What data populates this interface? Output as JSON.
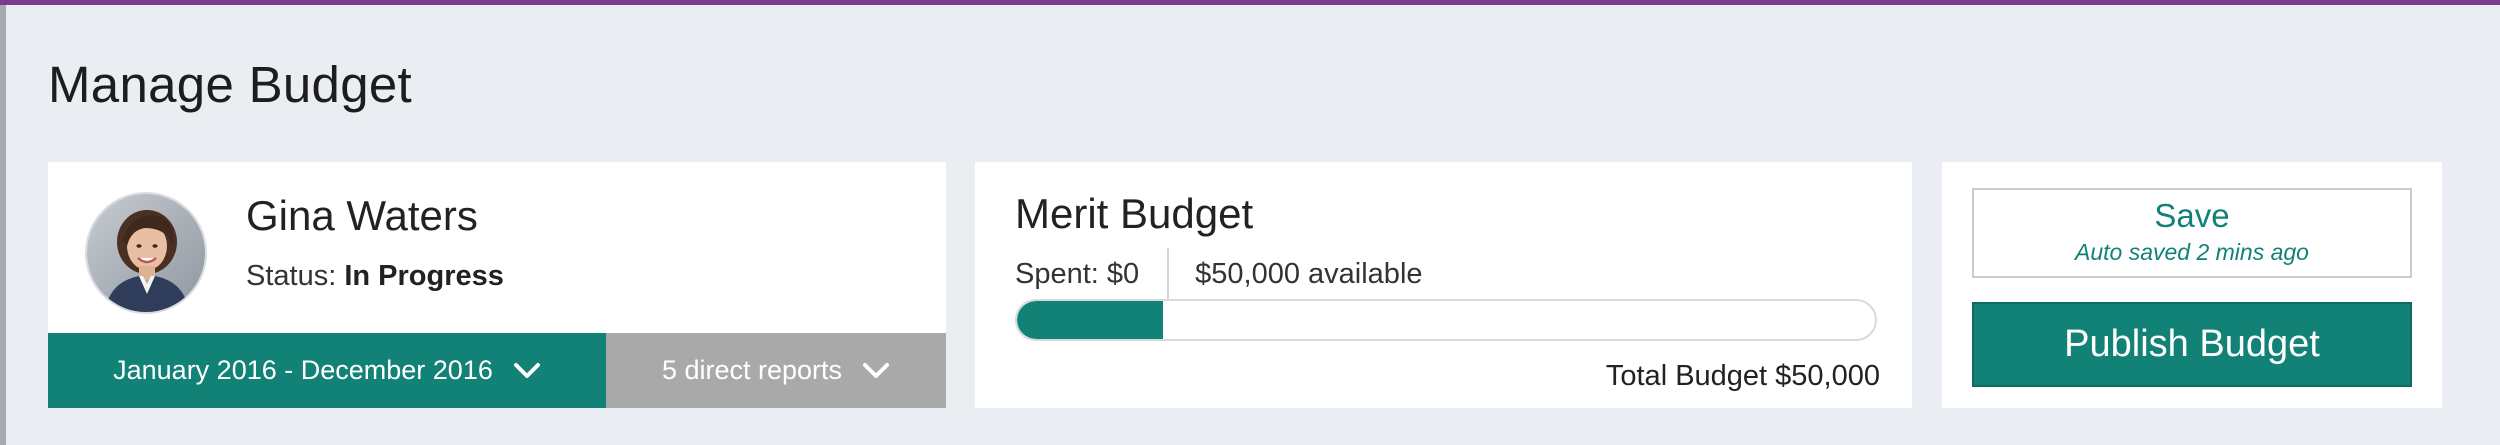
{
  "page": {
    "title": "Manage Budget",
    "accent_color": "#7b3b8e",
    "background_color": "#eaedf2"
  },
  "employee": {
    "name": "Gina Waters",
    "status_label": "Status:",
    "status_value": "In Progress",
    "avatar_icon": "person-photo",
    "period_label": "January 2016 - December 2016",
    "period_icon": "chevron-down-icon",
    "reports_label": "5 direct reports",
    "reports_icon": "chevron-down-icon",
    "period_color": "#128277",
    "reports_color": "#a9a9a9"
  },
  "budget": {
    "title": "Merit Budget",
    "spent_label": "Spent: $0",
    "available_label": "$50,000 available",
    "progress_fraction": 0.17,
    "progress_color": "#128277",
    "total_label": "Total Budget $50,000"
  },
  "actions": {
    "save_label": "Save",
    "autosave_label": "Auto saved 2 mins ago",
    "publish_label": "Publish Budget",
    "primary_color": "#128277"
  }
}
